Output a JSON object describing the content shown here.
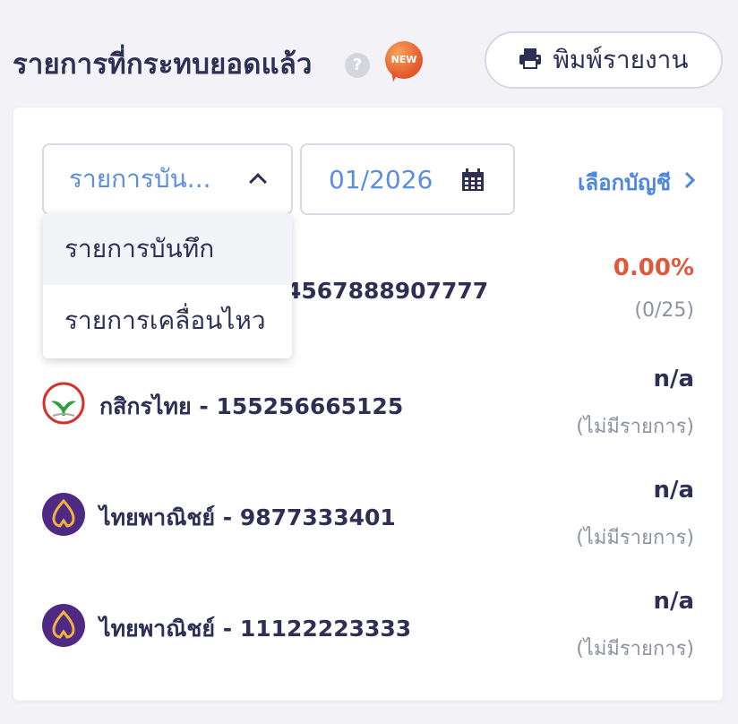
{
  "header": {
    "title": "รายการที่กระทบยอดแล้ว",
    "help_label": "?",
    "new_badge": "NEW",
    "print_label": "พิมพ์รายงาน",
    "print_icon": "printer-icon"
  },
  "filters": {
    "transaction_type": "รายการบัน...",
    "month": "01/2026",
    "calendar_icon": "calendar-icon",
    "select_account_label": "เลือกบัญชี",
    "dropdown_options": [
      {
        "label": "รายการบันทึก",
        "selected": true
      },
      {
        "label": "รายการเคลื่อนไหว",
        "selected": false
      }
    ]
  },
  "accounts": [
    {
      "bank": "",
      "number": "4567888907777",
      "logo": "",
      "rate": "0.00%",
      "sub": "(0/25)",
      "rate_color": "#df5a3a"
    },
    {
      "bank": "กสิกรไทย",
      "number": "155256665125",
      "logo": "kbank-logo-icon",
      "rate": "n/a",
      "sub": "(ไม่มีรายการ)",
      "rate_color": "#2e2f55"
    },
    {
      "bank": "ไทยพาณิชย์",
      "number": "9877333401",
      "logo": "scb-logo-icon",
      "rate": "n/a",
      "sub": "(ไม่มีรายการ)",
      "rate_color": "#2e2f55"
    },
    {
      "bank": "ไทยพาณิชย์",
      "number": "11122223333",
      "logo": "scb-logo-icon",
      "rate": "n/a",
      "sub": "(ไม่มีรายการ)",
      "rate_color": "#2e2f55"
    }
  ],
  "colors": {
    "accent": "#4b86e0",
    "title": "#2e2f55",
    "percent": "#df5a3a",
    "kbank_green": "#2e9c3f",
    "kbank_red": "#d6322c",
    "scb_purple": "#4e2a84",
    "scb_gold": "#f2b33d"
  }
}
